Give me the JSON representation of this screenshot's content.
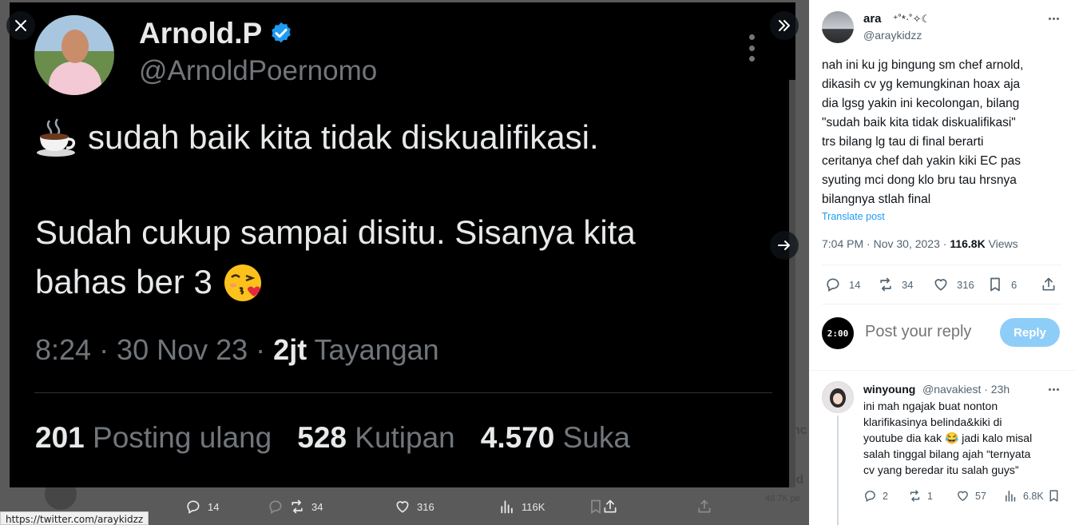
{
  "viewer": {
    "close_label": "close",
    "collapse_label": "collapse",
    "next_label": "next"
  },
  "screenshot": {
    "name": "Arnold.P",
    "handle": "@ArnoldPoernomo",
    "line1": "sudah baik kita tidak diskualifikasi.",
    "line2": "Sudah cukup sampai disitu. Sisanya kita",
    "line3": "bahas ber 3",
    "meta_time": "8:24 · 30 Nov 23 · ",
    "meta_views_num": "2jt",
    "meta_views_label": "Tayangan",
    "reposts_num": "201",
    "reposts_label": "Posting ulang",
    "quotes_num": "528",
    "quotes_label": "Kutipan",
    "likes_num": "4.570",
    "likes_label": "Suka"
  },
  "viewer_actions": {
    "replies": "14",
    "reposts": "34",
    "likes": "316",
    "views": "116K"
  },
  "background": {
    "side_letter_1": "nc",
    "side_letter_2": "ld",
    "side_letter_3": "d",
    "side_count": "48.7K pe"
  },
  "status_bar": {
    "url": "https://twitter.com/araykidzz"
  },
  "panel": {
    "author_name": "ara",
    "author_decor": "⁺˚*·˚✧☾",
    "author_handle": "@araykidzz",
    "text_lines": [
      "nah ini ku jg bingung sm chef arnold,",
      "dikasih cv yg kemungkinan hoax aja",
      "dia lgsg yakin ini kecolongan, bilang",
      "\"sudah baik kita tidak diskualifikasi\"",
      "trs bilang lg tau di final berarti",
      "ceritanya chef dah yakin kiki EC pas",
      "syuting mci dong klo bru tau hrsnya",
      "bilangnya stlah final"
    ],
    "translate": "Translate post",
    "timestamp": "7:04 PM · Nov 30, 2023 · ",
    "views_num": "116.8K",
    "views_label": " Views",
    "actions": {
      "replies": "14",
      "reposts": "34",
      "likes": "316",
      "bookmarks": "6"
    },
    "reply_avatar_text": "2:00",
    "reply_placeholder": "Post your reply",
    "reply_button": "Reply",
    "reply": {
      "name": "winyoung",
      "handle": "@navakiest · 23h",
      "lines": [
        "ini mah ngajak buat nonton",
        "klarifikasinya belinda&kiki di",
        "youtube dia kak 😂 jadi kalo misal",
        "salah tinggal bilang ajah “ternyata",
        "cv yang beredar itu salah guys”"
      ],
      "replies": "2",
      "reposts": "1",
      "likes": "57",
      "views": "6.8K"
    }
  },
  "colors": {
    "verified": "#1d9bf0",
    "link": "#1d9bf0",
    "reply_button_disabled": "#8ecdf8",
    "muted": "#536471"
  }
}
